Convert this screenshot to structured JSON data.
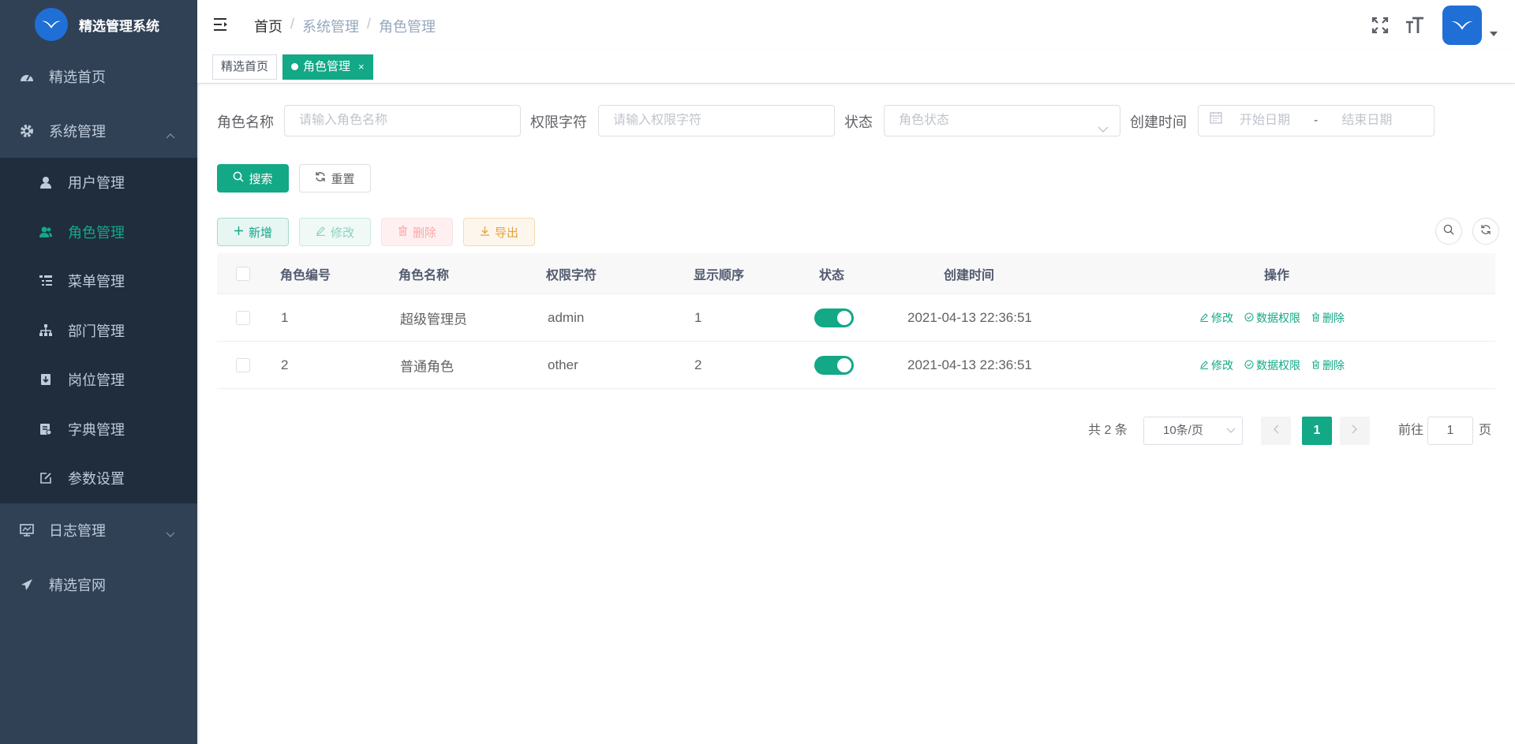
{
  "app": {
    "title": "精选管理系统"
  },
  "sidebar": {
    "items": [
      {
        "label": "精选首页",
        "icon": "dashboard-icon"
      },
      {
        "label": "系统管理",
        "icon": "gear-icon",
        "expanded": true,
        "children": [
          {
            "label": "用户管理",
            "icon": "user-icon"
          },
          {
            "label": "角色管理",
            "icon": "peoples-icon",
            "active": true
          },
          {
            "label": "菜单管理",
            "icon": "tree-table-icon"
          },
          {
            "label": "部门管理",
            "icon": "tree-icon"
          },
          {
            "label": "岗位管理",
            "icon": "post-icon"
          },
          {
            "label": "字典管理",
            "icon": "dict-icon"
          },
          {
            "label": "参数设置",
            "icon": "edit-icon"
          }
        ]
      },
      {
        "label": "日志管理",
        "icon": "log-icon",
        "expanded": false
      },
      {
        "label": "精选官网",
        "icon": "send-icon"
      }
    ]
  },
  "breadcrumb": {
    "home": "首页",
    "sep": "/",
    "level1": "系统管理",
    "level2": "角色管理"
  },
  "tags": {
    "home": "精选首页",
    "active": "角色管理",
    "close": "×"
  },
  "search": {
    "role_name_label": "角色名称",
    "role_name_placeholder": "请输入角色名称",
    "perm_label": "权限字符",
    "perm_placeholder": "请输入权限字符",
    "status_label": "状态",
    "status_placeholder": "角色状态",
    "time_label": "创建时间",
    "start_placeholder": "开始日期",
    "range_sep": "-",
    "end_placeholder": "结束日期",
    "search_btn": "搜索",
    "reset_btn": "重置"
  },
  "toolbar": {
    "add": "新增",
    "edit": "修改",
    "delete": "删除",
    "export": "导出"
  },
  "table": {
    "headers": {
      "id": "角色编号",
      "name": "角色名称",
      "key": "权限字符",
      "sort": "显示顺序",
      "status": "状态",
      "created": "创建时间",
      "ops": "操作"
    },
    "rows": [
      {
        "id": "1",
        "name": "超级管理员",
        "key": "admin",
        "sort": "1",
        "status_on": true,
        "created": "2021-04-13 22:36:51"
      },
      {
        "id": "2",
        "name": "普通角色",
        "key": "other",
        "sort": "2",
        "status_on": true,
        "created": "2021-04-13 22:36:51"
      }
    ],
    "ops": {
      "edit": "修改",
      "data_scope": "数据权限",
      "delete": "删除"
    }
  },
  "pagination": {
    "total": "共 2 条",
    "page_size": "10条/页",
    "current": "1",
    "goto_label": "前往",
    "goto_value": "1",
    "page_unit": "页"
  },
  "colors": {
    "primary": "#13a886",
    "sidebar_bg": "#304156",
    "submenu_bg": "#1f2d3d",
    "logo": "#1f6fd6"
  }
}
